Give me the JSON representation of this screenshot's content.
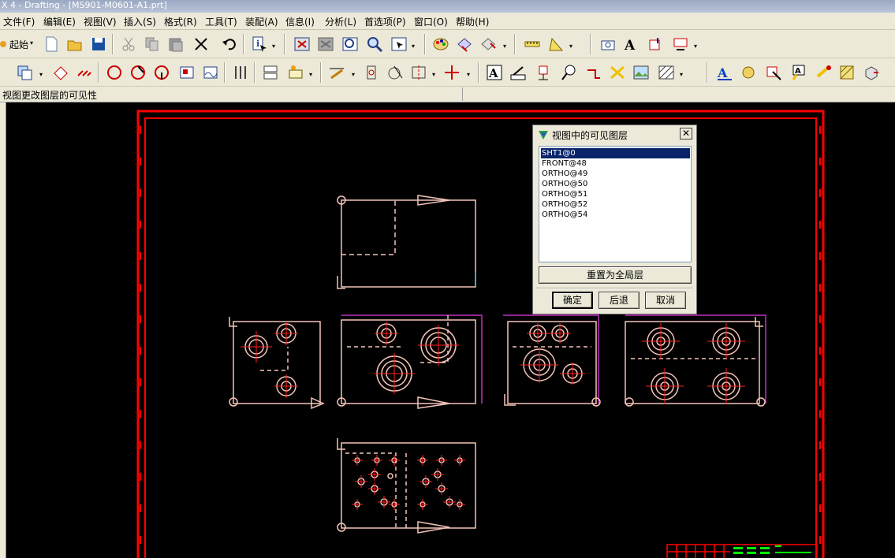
{
  "window": {
    "title": "X 4 - Drafting - [MS901-M0601-A1.prt]"
  },
  "menu": [
    {
      "label": "文件(F)"
    },
    {
      "label": "编辑(E)"
    },
    {
      "label": "视图(V)"
    },
    {
      "label": "插入(S)"
    },
    {
      "label": "格式(R)"
    },
    {
      "label": "工具(T)"
    },
    {
      "label": "装配(A)"
    },
    {
      "label": "信息(I)"
    },
    {
      "label": "分析(L)"
    },
    {
      "label": "首选项(P)"
    },
    {
      "label": "窗口(O)"
    },
    {
      "label": "帮助(H)"
    }
  ],
  "toolbar": {
    "start_label": "起始"
  },
  "status": {
    "prompt": "视图更改图层的可见性"
  },
  "dialog": {
    "title": "视图中的可见图层",
    "layers": [
      "SHT1@0",
      "FRONT@48",
      "ORTHO@49",
      "ORTHO@50",
      "ORTHO@51",
      "ORTHO@52",
      "ORTHO@54"
    ],
    "selected_index": 0,
    "reset_label": "重置为全局层",
    "ok_label": "确定",
    "back_label": "后退",
    "cancel_label": "取消"
  },
  "colors": {
    "border_red": "#ff0000",
    "geometry_pink": "#f4c4b8",
    "hidden_pink": "#f4c4b8",
    "centerline_red": "#ff2020",
    "view_border_magenta": "#c030c0",
    "titleblock_green": "#00ff00"
  }
}
